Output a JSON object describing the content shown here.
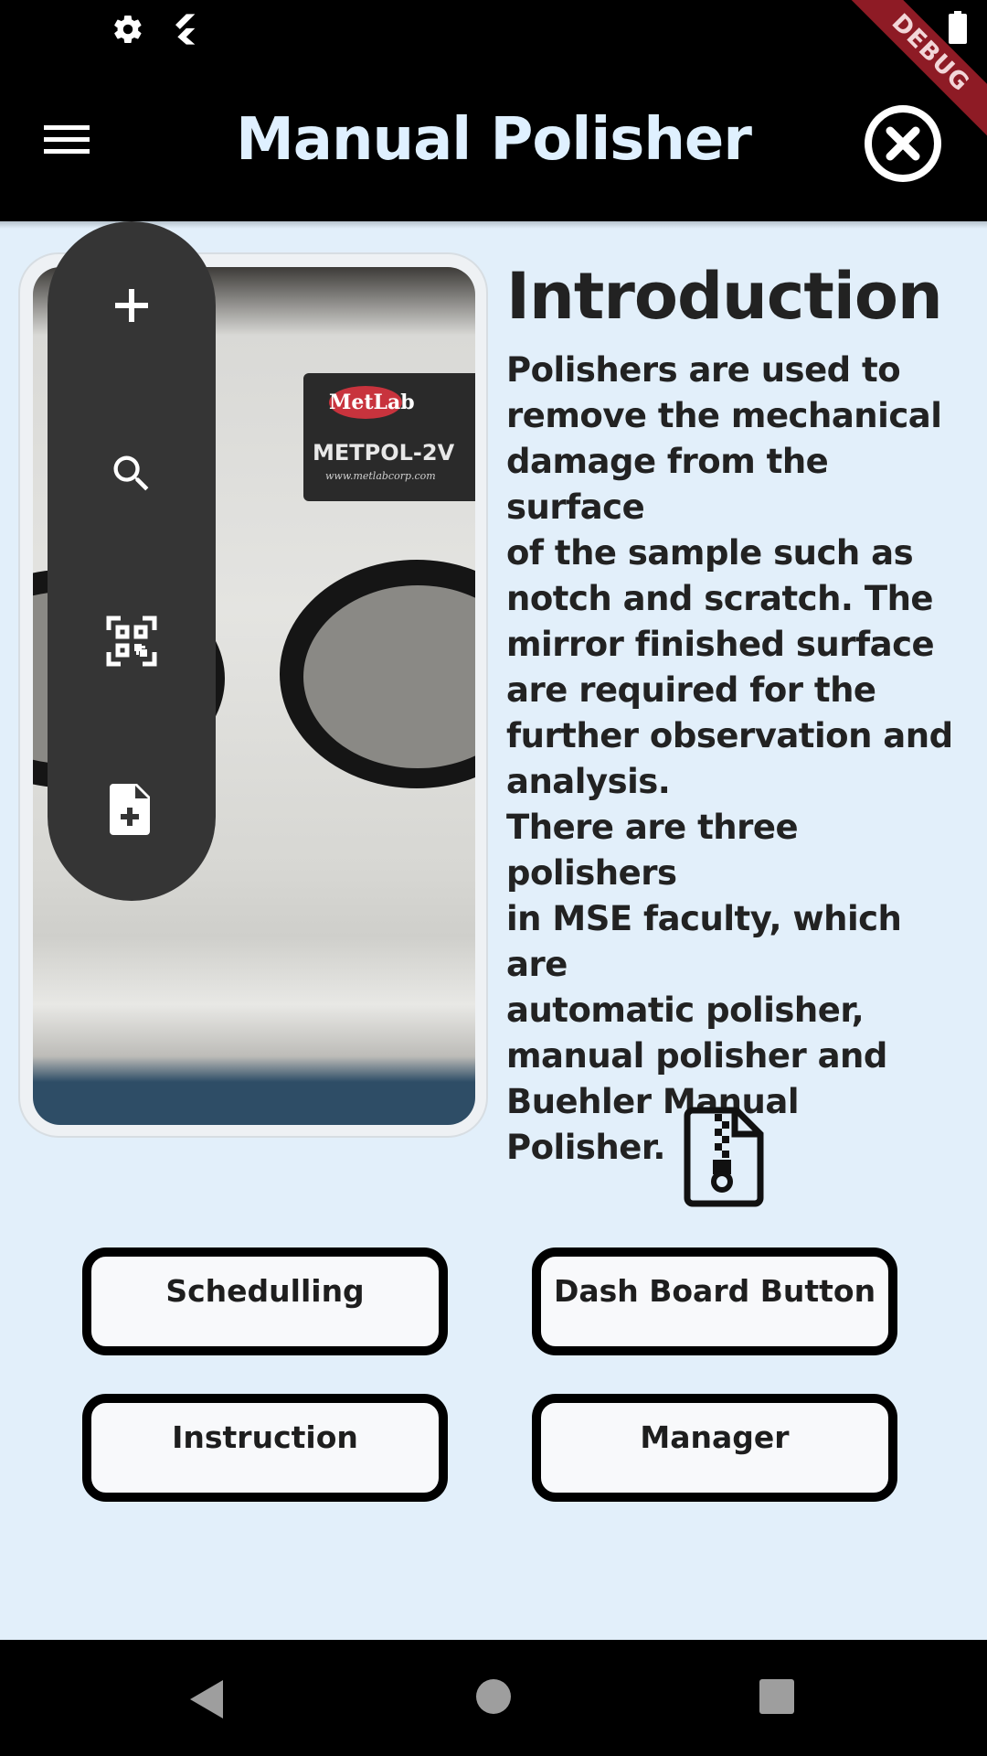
{
  "status_bar": {
    "left_icons": [
      "gear-icon",
      "flutter-icon"
    ],
    "right_icons": [
      "battery-icon"
    ],
    "debug_banner": "DEBUG"
  },
  "app_bar": {
    "title": "Manual Polisher",
    "menu_icon": "hamburger-menu-icon",
    "close_icon": "close-circle-icon"
  },
  "photo": {
    "description_icons": [
      "metlab-logo"
    ],
    "device_brand": "MetLab",
    "device_model": "METPOL-2V",
    "device_url": "www.metlabcorp.com"
  },
  "fab_menu": {
    "items": [
      {
        "icon": "plus-icon"
      },
      {
        "icon": "search-icon"
      },
      {
        "icon": "qr-scan-icon"
      },
      {
        "icon": "add-file-icon"
      }
    ]
  },
  "intro": {
    "heading": "Introduction",
    "body": "Polishers are used to\nremove the mechanical\ndamage from the surface\nof the sample such as\nnotch and scratch. The\nmirror finished surface\nare required for the\nfurther observation and\nanalysis.\nThere are three polishers\nin MSE faculty, which are\nautomatic polisher,\nmanual polisher and\nBuehler Manual Polisher."
  },
  "zip_icon": "zip-file-icon",
  "buttons": {
    "scheduling": "Schedulling",
    "dashboard": "Dash Board Button",
    "instruction": "Instruction",
    "manager": "Manager"
  },
  "nav_bar": {
    "icons": [
      "back-triangle-icon",
      "home-circle-icon",
      "recents-square-icon"
    ]
  },
  "colors": {
    "background": "#e2effa",
    "bar": "#000000",
    "title": "#dff0ff",
    "fab": "#353535",
    "debug": "#8e1b25"
  }
}
